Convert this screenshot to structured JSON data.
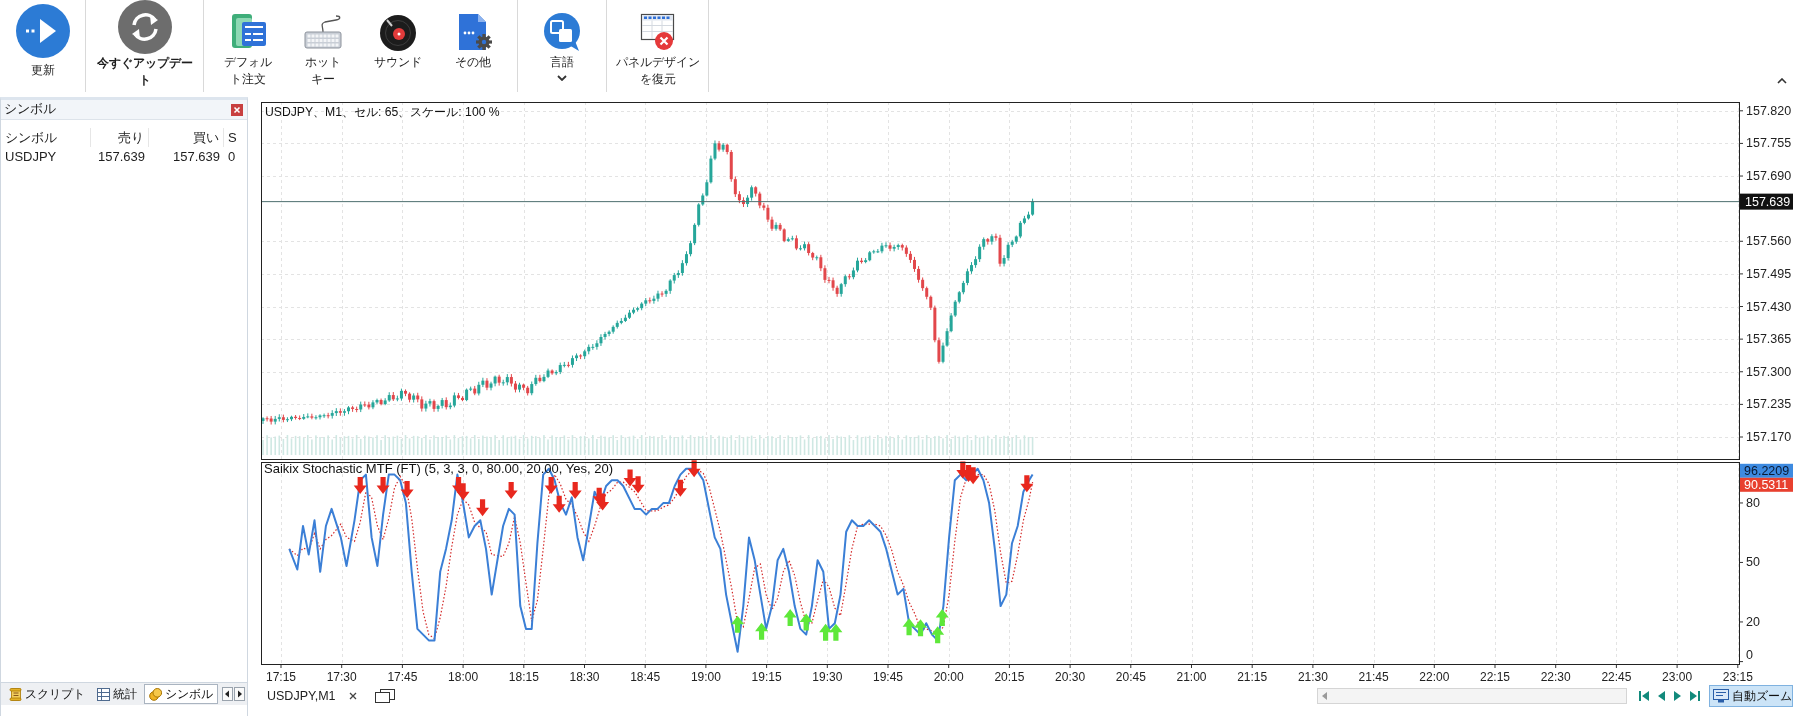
{
  "toolbar": {
    "groups": [
      [
        {
          "kind": "refresh",
          "label": "更新",
          "dropdown": false
        }
      ],
      [
        {
          "kind": "update",
          "label": "今すぐアップデート",
          "dropdown": false
        }
      ],
      [
        {
          "kind": "order",
          "label": "デフォルト注文",
          "dropdown": false
        },
        {
          "kind": "hotkey",
          "label": "ホットキー",
          "dropdown": false
        },
        {
          "kind": "sound",
          "label": "サウンド",
          "dropdown": false
        },
        {
          "kind": "other",
          "label": "その他",
          "dropdown": false
        }
      ],
      [
        {
          "kind": "language",
          "label": "言語",
          "dropdown": true
        }
      ],
      [
        {
          "kind": "restore",
          "label": "パネルデザインを復元",
          "dropdown": false
        }
      ]
    ]
  },
  "symbol_panel": {
    "title": "シンボル",
    "columns": [
      "シンボル",
      "売り",
      "買い",
      "S"
    ],
    "rows": [
      [
        "USDJPY",
        "157.639",
        "157.639",
        "0"
      ]
    ],
    "tabs": [
      {
        "kind": "scripts",
        "label": "スクリプト",
        "selected": false
      },
      {
        "kind": "stats",
        "label": "統計",
        "selected": false
      },
      {
        "kind": "symbols",
        "label": "シンボル",
        "selected": true
      }
    ]
  },
  "chart": {
    "title": "USDJPY、M1、セル: 65、スケール: 100 %",
    "price_ticks": [
      "157.820",
      "157.755",
      "157.690",
      "157.560",
      "157.495",
      "157.430",
      "157.365",
      "157.300",
      "157.235",
      "157.170"
    ],
    "current_price": "157.639",
    "indicator": {
      "title": "Saikix Stochastic MTF (FT) (5, 3, 3, 0, 80.00, 20.00, Yes, 20)",
      "ticks": [
        "80",
        "50",
        "20",
        "0"
      ],
      "main_value": "96.2209",
      "signal_value": "90.5311"
    },
    "time_ticks": [
      "17:15",
      "17:30",
      "17:45",
      "18:00",
      "18:15",
      "18:30",
      "18:45",
      "19:00",
      "19:15",
      "19:30",
      "19:45",
      "20:00",
      "20:15",
      "20:30",
      "20:45",
      "21:00",
      "21:15",
      "21:30",
      "21:45",
      "22:00",
      "22:15",
      "22:30",
      "22:45",
      "23:00",
      "23:15"
    ]
  },
  "bottom_bar": {
    "chart_tab": {
      "label": "USDJPY,M1",
      "selected": true
    },
    "auto_zoom": {
      "label": "自動ズーム",
      "on": true
    }
  }
}
